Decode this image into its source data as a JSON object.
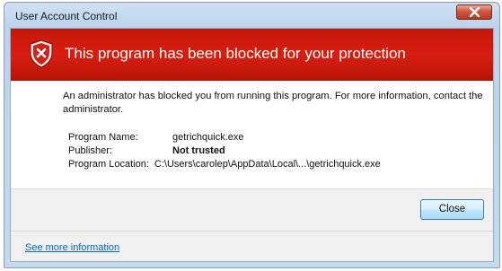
{
  "window": {
    "title": "User Account Control"
  },
  "banner": {
    "heading": "This program has been blocked for your protection",
    "color": "#c8180c"
  },
  "message": "An administrator has blocked you from running this program. For more information, contact the administrator.",
  "details": {
    "program_name_label": "Program Name:",
    "program_name_value": "getrichquick.exe",
    "publisher_label": "Publisher:",
    "publisher_value": "Not trusted",
    "location_label": "Program Location:",
    "location_value": "C:\\Users\\carolep\\AppData\\Local\\...\\getrichquick.exe"
  },
  "buttons": {
    "close_label": "Close"
  },
  "footer": {
    "more_info_link": "See more information"
  },
  "icons": {
    "shield": "shield-error-icon",
    "close": "close-icon"
  }
}
